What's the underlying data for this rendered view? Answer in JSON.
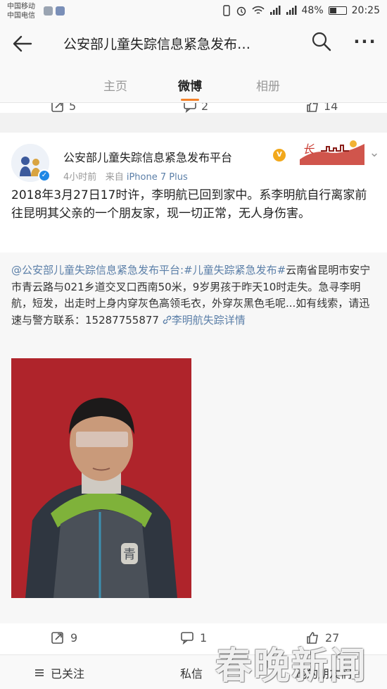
{
  "status_bar": {
    "carrier_1": "中国移动",
    "carrier_2": "中国电信",
    "signal_icons": [
      "vibrate-icon",
      "alarm-icon",
      "wifi-icon",
      "signal-icon",
      "signal-icon"
    ],
    "battery": "48%",
    "battery_level": 0.48,
    "time": "20:25"
  },
  "header": {
    "title": "公安部儿童失踪信息紧急发布…",
    "back_icon": "back-arrow-icon",
    "search_icon": "search-icon",
    "more_icon": "more-icon"
  },
  "tabs": [
    {
      "label": "主页",
      "active": false
    },
    {
      "label": "微博",
      "active": true
    },
    {
      "label": "相册",
      "active": false
    }
  ],
  "prev_post_actions": {
    "repost": "5",
    "comment": "2",
    "like": "14"
  },
  "post": {
    "account_name": "公安部儿童失踪信息紧急发布平台",
    "time": "4小时前",
    "from_label": "来自",
    "source": "iPhone 7 Plus",
    "banner_text": "长",
    "body": "2018年3月27日17时许，李明航已回到家中。系李明航自行离家前往昆明其父亲的一个朋友家，现一切正常，无人身伤害。",
    "repost": {
      "mention": "@公安部儿童失踪信息紧急发布平台",
      "hashtag": ":#儿童失踪紧急发布#",
      "text": "云南省昆明市安宁市青云路与021乡道交叉口西南50米，9岁男孩于昨天10时走失。急寻李明航，短发，出走时上身内穿灰色高领毛衣，外穿灰黑色毛呢...如有线索，请迅速与警方联系：15287755877",
      "link_text": "李明航失踪详情",
      "badge_text": "青"
    },
    "actions": {
      "repost": "9",
      "comment": "1",
      "like": "27"
    }
  },
  "bottom_bar": {
    "follow": "已关注",
    "message": "私信",
    "more": "他的朋友们"
  },
  "watermark": "春晚新闻",
  "colors": {
    "accent": "#f3822a",
    "link": "#5b7fa8",
    "verified": "#1e88e5",
    "photo_bg": "#b5262c"
  }
}
